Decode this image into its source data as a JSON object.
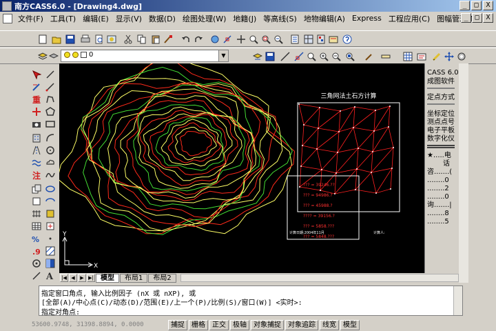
{
  "window": {
    "title": "南方CASS6.0 - [Drawing4.dwg]",
    "controls": [
      "_",
      "□",
      "X"
    ]
  },
  "menubar": {
    "items": [
      "文件(F)",
      "工具(T)",
      "编辑(E)",
      "显示(V)",
      "数据(D)",
      "绘图处理(W)",
      "地籍(J)",
      "等高线(S)",
      "地物编辑(A)",
      "Express",
      "工程应用(C)",
      "图幅管理(M)"
    ],
    "doc_controls": [
      "_",
      "□",
      "X"
    ]
  },
  "toolbar2": {
    "layer_value": "0"
  },
  "canvas": {
    "inset_title": "三角网法土石方计算",
    "volume_lines": [
      "??? = 39246.??",
      "??? = 94986.?",
      "??? = 45988.?",
      "???? = 39156.?",
      "??? = 5858.???",
      "??? = 5848.???"
    ],
    "label_left": "计算日期:2004年11月",
    "label_right": "计算人:",
    "ucs_x": "X",
    "ucs_y": "Y"
  },
  "right_panel": {
    "items": [
      "CASS 6.0",
      "成图软件",
      "定点方式",
      "坐标定位",
      "测点点号",
      "电子平板",
      "数字化仪",
      "★.....电",
      "话",
      "咨.......(",
      "........0",
      "........2",
      "........0",
      "询.......|",
      "........8",
      "........5"
    ]
  },
  "tabs": {
    "items": [
      "模型",
      "布局1",
      "布局2"
    ],
    "active": "模型"
  },
  "command": {
    "line1": "指定窗口角点, 输入比例因子 (nX 或 nXP), 或",
    "line2": "[全部(A)/中心点(C)/动态(D)/范围(E)/上一个(P)/比例(S)/窗口(W)] <实时>:",
    "line3": "指定对角点:"
  },
  "statusbar": {
    "coords": "53600.9748, 31398.8894, 0.0000",
    "buttons": [
      "捕捉",
      "栅格",
      "正交",
      "极轴",
      "对象捕捉",
      "对象追踪",
      "线宽",
      "模型"
    ]
  },
  "colors": {
    "title_start": "#0a246a",
    "title_end": "#a6caf0",
    "canvas_bg": "#000000",
    "contour_a": "#ffff66",
    "contour_b": "#ff2a1a",
    "contour_c": "#44dd33",
    "triangle": "#ff2020",
    "frame": "#ffffff"
  },
  "icons": {
    "toolbar1": [
      "new-icon",
      "open-icon",
      "save-icon",
      "print-icon",
      "preview-icon",
      "publish-icon",
      "cut-icon",
      "copy-icon",
      "paste-icon",
      "match-icon",
      "undo-icon",
      "redo-icon",
      "hyperlink-icon",
      "snap-icon",
      "pan-icon",
      "zoom-realtime-icon",
      "zoom-window-icon",
      "zoom-previous-icon",
      "properties-icon",
      "design-center-icon",
      "tool-palette-icon",
      "markup-icon",
      "help-icon"
    ],
    "toolbar2": [
      "layers-icon",
      "layer-state-icon",
      "layer-previous-icon",
      "save-icon",
      "zoom-icon",
      "zoom-in-icon",
      "zoom-out-icon",
      "zoom-all-icon",
      "line-icon",
      "dimension-icon",
      "ruler-icon",
      "move-icon"
    ],
    "left": [
      "select-icon",
      "pencil-icon",
      "line-icon",
      "polyline-icon",
      "mark-icon",
      "arc-icon",
      "square-icon",
      "polygon-icon",
      "circle-icon",
      "rectangle-icon",
      "cloud-icon",
      "arc-icon",
      "spline-icon",
      "ellipse-icon",
      "ellipse-arc-icon",
      "block-icon",
      "region-icon",
      "hatch-icon",
      "gradient-icon",
      "table-icon",
      "dot-icon",
      "multiline-text-icon",
      "text-icon"
    ]
  }
}
